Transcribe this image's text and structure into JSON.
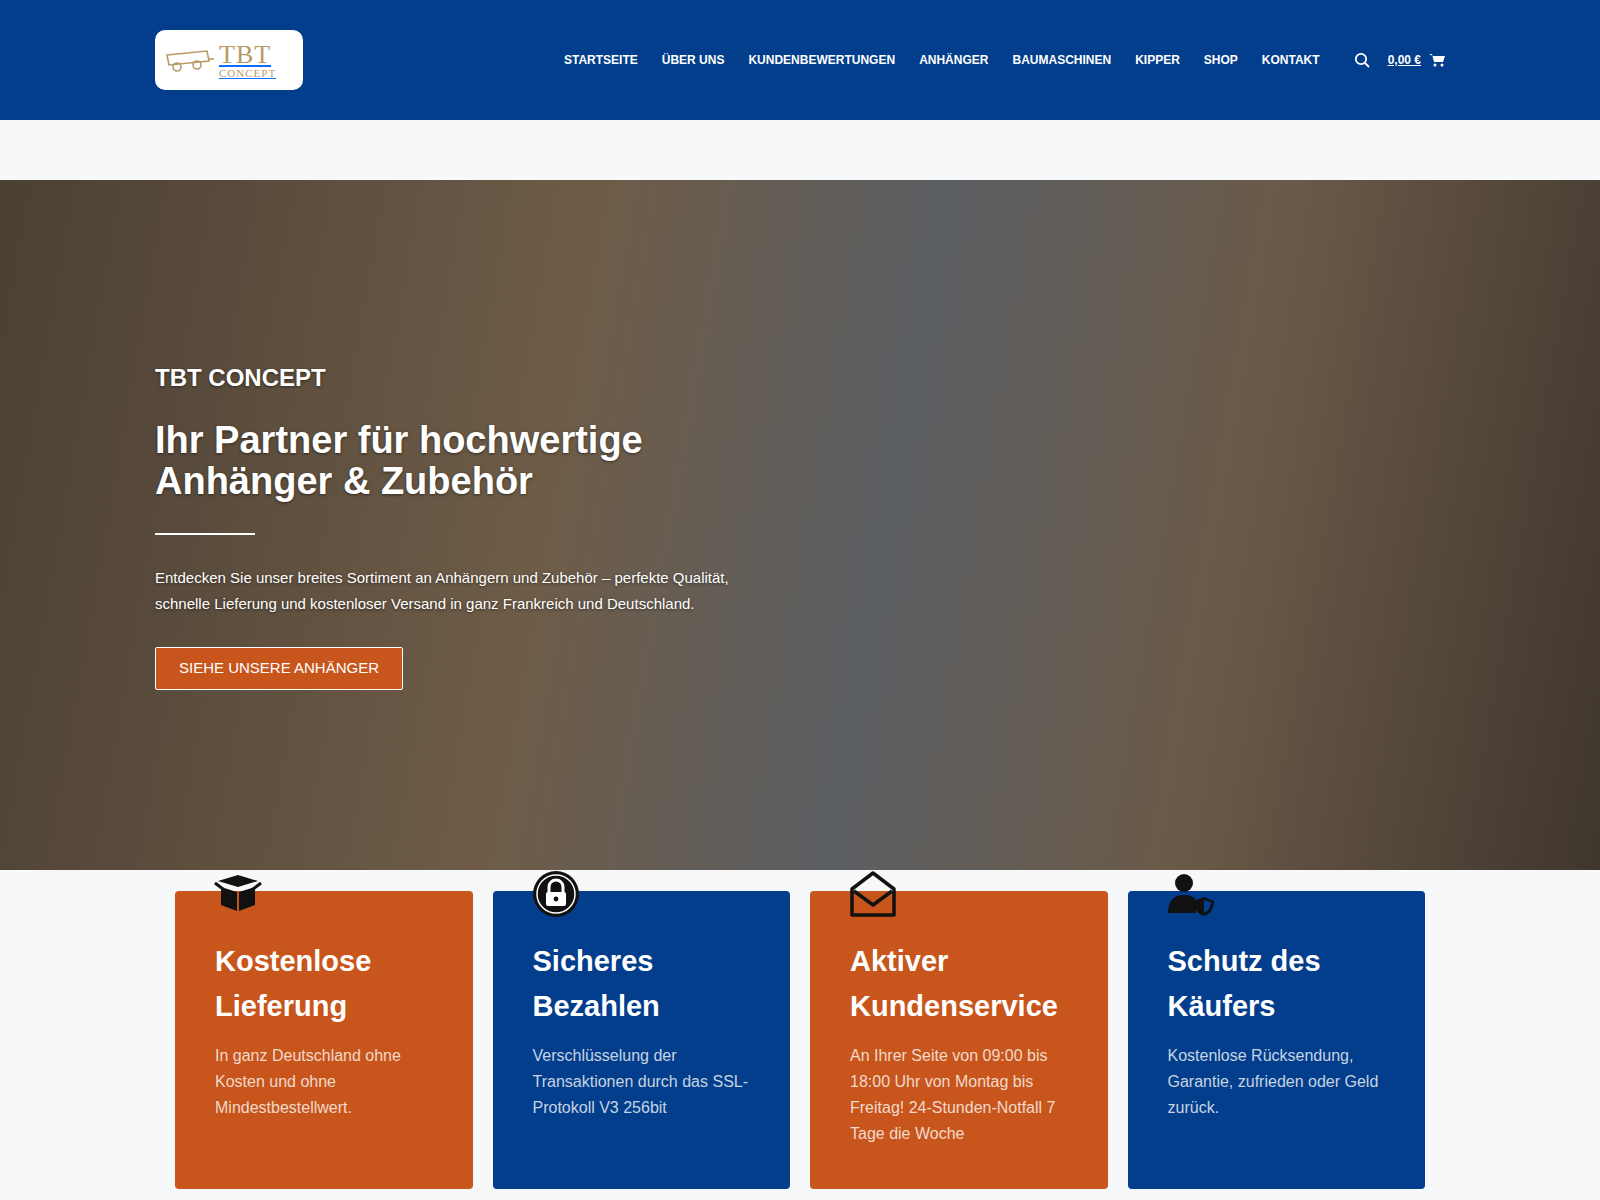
{
  "header": {
    "logo": {
      "main": "TBT",
      "sub": "CONCEPT"
    },
    "nav": [
      {
        "label": "STARTSEITE"
      },
      {
        "label": "ÜBER UNS"
      },
      {
        "label": "KUNDENBEWERTUNGEN"
      },
      {
        "label": "ANHÄNGER"
      },
      {
        "label": "BAUMASCHINEN"
      },
      {
        "label": "KIPPER"
      },
      {
        "label": "SHOP"
      },
      {
        "label": "KONTAKT"
      }
    ],
    "cart": "0,00 €"
  },
  "hero": {
    "eyebrow": "TBT CONCEPT",
    "title_lines": [
      "Ihr Partner für hochwertige",
      "Anhänger & Zubehör"
    ],
    "text": "Entdecken Sie unser breites Sortiment an Anhängern und Zubehör – perfekte Qualität, schnelle Lieferung und kostenloser Versand in ganz Frankreich und Deutschland.",
    "button": "SIEHE UNSERE ANHÄNGER"
  },
  "features": [
    {
      "title": "Kostenlose Lieferung",
      "text": "In ganz Deutschland ohne Kosten und ohne Mindestbestellwert.",
      "color": "#c8561c"
    },
    {
      "title": "Sicheres Bezahlen",
      "text": "Verschlüsselung der Transaktionen durch das SSL-Protokoll V3 256bit",
      "color": "#033e8c"
    },
    {
      "title": "Aktiver Kundenservice",
      "text": "An Ihrer Seite von 09:00 bis 18:00 Uhr von Montag bis Freitag! 24-Stunden-Notfall 7 Tage die Woche",
      "color": "#c8561c"
    },
    {
      "title": "Schutz des Käufers",
      "text": "Kostenlose Rücksendung, Garantie, zufrieden oder Geld zurück.",
      "color": "#033e8c"
    }
  ]
}
